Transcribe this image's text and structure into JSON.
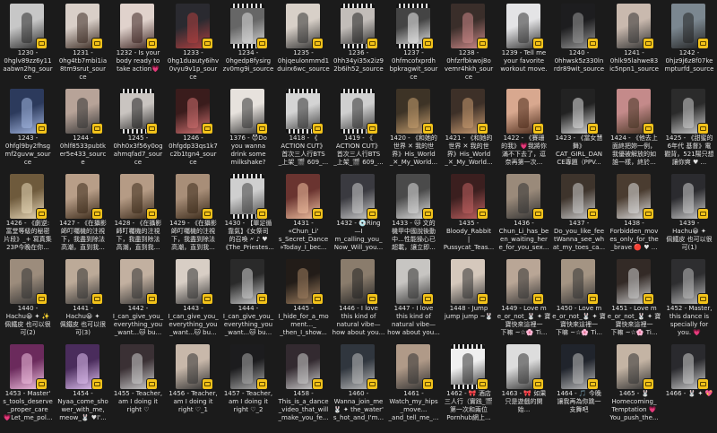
{
  "explorer": {
    "tiles": [
      {
        "name": "1230 - 0hglv89zz6y11aabwn2hg_source",
        "label": "1230 -\n0hglv89zz6y11\naabwn2hg_sour\nce",
        "bg": "#c7c7c7",
        "fg": "#2a2a2a",
        "film": false
      },
      {
        "name": "1231 - 0hgi4tb7mbi1ia8tm9srut_source",
        "label": "1231 -\n0hg4tb7mbi1ia\n8tm9srut_sour\nce",
        "bg": "#d9cfc8",
        "fg": "#3a2a22",
        "film": false
      },
      {
        "name": "1232 - Is your body ready to take action",
        "label": "1232 - Is your\nbody ready to\ntake action💗",
        "bg": "#e0d2cc",
        "fg": "#3b2320",
        "film": false
      },
      {
        "name": "1233 - 0hgl0uaeuty6ihv0vyu9v1p_source",
        "label": "1233 -\n0hg1duauty6ihv\n0vyu9v1p_sour\nce",
        "bg": "#2a2a30",
        "fg": "#b04040",
        "film": false
      },
      {
        "name": "1234",
        "label": "1234 -\n0hgedp8fysirg\nzv0mg9i_source",
        "bg": "#666",
        "fg": "#ddd",
        "film": true
      },
      {
        "name": "1235",
        "label": "1235 -\n0hjqeulonmmd1\nduirx6wc_source",
        "bg": "#d8d0c8",
        "fg": "#333",
        "film": false
      },
      {
        "name": "1236",
        "label": "1236 -\n0hh34yi35x2iz9\n2b6ih52_source",
        "bg": "#c2bdb9",
        "fg": "#222",
        "film": true
      },
      {
        "name": "1237",
        "label": "1237 -\n0hfmcofxprdh\nbpkragwit_sour\nce",
        "bg": "#444",
        "fg": "#eee",
        "film": true
      },
      {
        "name": "1238",
        "label": "1238 -\n0hfzrfbkwoj8o\nvemr4hkh_sour\nce",
        "bg": "#3a2e2a",
        "fg": "#c88",
        "film": false
      },
      {
        "name": "1239",
        "label": "1239 - Tell me\nyour favorite\nworkout move.",
        "bg": "#e4e4e6",
        "fg": "#333",
        "film": false
      },
      {
        "name": "1240",
        "label": "1240 -\n0hhwsk5z330ln\nrdr89wit_source",
        "bg": "#1d1d1f",
        "fg": "#999",
        "film": false
      },
      {
        "name": "1241",
        "label": "1241 -\n0hlk95lahwe83\nic5npn1_source",
        "bg": "#c9b9ae",
        "fg": "#333",
        "film": false
      },
      {
        "name": "1242",
        "label": "1242 -\n0hjz9j6z8f07ke\nmpturfd_source",
        "bg": "#7b8790",
        "fg": "#222",
        "film": false
      },
      {
        "name": "1243",
        "label": "1243 -\n0hfgl9by2fhsg\nmf2guvw_sour\nce",
        "bg": "#2c3a5c",
        "fg": "#a3b6e0",
        "film": false
      },
      {
        "name": "1244",
        "label": "1244 -\n0hlf8533pubtk\ner5e433_sourc\ne",
        "bg": "#b7a398",
        "fg": "#333",
        "film": false
      },
      {
        "name": "1245",
        "label": "1245 -\n0hh0x3f56y0og\nahmqfad7_sour\nce",
        "bg": "#c9c4c0",
        "fg": "#222",
        "film": true
      },
      {
        "name": "1246",
        "label": "1246 -\n0hfgdp33qs1k7\nc2b1tgn4_sour\nce",
        "bg": "#3a1c1c",
        "fg": "#d07070",
        "film": false
      },
      {
        "name": "1376",
        "label": "1376 - 😈Do\nyou wanna\ndrink some\nmilkshake?",
        "bg": "#e7e2dd",
        "fg": "#333",
        "film": false
      },
      {
        "name": "1418",
        "label": "1418 - 《\nACTION CUT》\n首次三人行BTS\n_上架_🎬 609_...",
        "bg": "#d4d4d4",
        "fg": "#333",
        "film": true
      },
      {
        "name": "1419",
        "label": "1419 - 《\nACTION CUT》\n首次三人行BTS\n_上架_🎬 609_...",
        "bg": "#cfcfcf",
        "fg": "#333",
        "film": true
      },
      {
        "name": "1420",
        "label": "1420 - 《和她的\n世界 ✕ 我的世\n界》His_World\n_✕_My_World...",
        "bg": "#3d3326",
        "fg": "#c8a070",
        "film": false
      },
      {
        "name": "1421",
        "label": "1421 - 《和她的\n世界 ✕ 我的世\n界》His_World\n_✕_My_World...",
        "bg": "#3d3028",
        "fg": "#c89a70",
        "film": false
      },
      {
        "name": "1422",
        "label": "1422 - 《賽珊\n的我》💗我將你\n滿不下去了，逗\n奈再第一次...",
        "bg": "#d8a88f",
        "fg": "#4a2a1a",
        "film": false
      },
      {
        "name": "1423",
        "label": "1423 - 《當女慧\n舞》\nCAT_GIRL_DAN\nCE專題（PPV...",
        "bg": "#222",
        "fg": "#ddd",
        "film": false
      },
      {
        "name": "1424",
        "label": "1424 - 《他去上\n面終把妳一例，\n我優被解放的如\n誰一樣，終於...",
        "bg": "#c48a8a",
        "fg": "#432",
        "film": false
      },
      {
        "name": "1425",
        "label": "1425 - 《甜蜜的\n6年代 基督》電\n觀背，521陽只想\n讓你爽 ♥ ...",
        "bg": "#2b2b2b",
        "fg": "#ccc",
        "film": false
      },
      {
        "name": "1426",
        "label": "1426 - 《劇逆:\n富堂等級的秘密\n片段》_+ 寫真集\n23P今晚在你...",
        "bg": "#6e5a3c",
        "fg": "#e8d8b8",
        "film": false
      },
      {
        "name": "1427",
        "label": "1427 - 《在攝影\n師叮囑機的注視\n下，我盡到除法\n高潮，直到我...",
        "bg": "#b89e88",
        "fg": "#3a2a1a",
        "film": false
      },
      {
        "name": "1428",
        "label": "1428 - 《在攝影\n師叮囑機的注視\n下，我盡到除法\n高潮，直到我...",
        "bg": "#b59b85",
        "fg": "#3a2a1a",
        "film": false
      },
      {
        "name": "1429",
        "label": "1429 - 《在攝影\n師叮囑機的注視\n下，我盡到除法\n高潮，直到我...",
        "bg": "#a88e78",
        "fg": "#3a2a1a",
        "film": false
      },
      {
        "name": "1430",
        "label": "1430 - 【單足循\n靠氣】《女祭司\n的召喚 🗲 ♪ ♥\n《The_Priestes...",
        "bg": "#cfcfcf",
        "fg": "#444",
        "film": true
      },
      {
        "name": "1431",
        "label": "1431 -\n«Chun_Li'\ns_Secret_Dance\n»Today_I_bec...",
        "bg": "#6a3430",
        "fg": "#f0c0a0",
        "film": false
      },
      {
        "name": "1432",
        "label": "1432 - 💿Ring\n—I\nm_calling_you_\nNow_Will_you...",
        "bg": "#3a3a40",
        "fg": "#ccc",
        "film": false
      },
      {
        "name": "1433",
        "label": "1433 - 🐱 文的\n機甲中國說後動\n中...性能操心已\n超載，讓立即...",
        "bg": "#4a4a4a",
        "fg": "#ddd",
        "film": false
      },
      {
        "name": "1435",
        "label": "1435 -\nBloody_Rabbit\n|\nPussycat_Teas...",
        "bg": "#3b1f1f",
        "fg": "#c06060",
        "film": false
      },
      {
        "name": "1436",
        "label": "1436 -\nChun_Li_has_be\nen_waiting_her\ne_for_you_sex...",
        "bg": "#9a8a7a",
        "fg": "#333",
        "film": false
      },
      {
        "name": "1437",
        "label": "1437 -\nDo_you_like_fee\ntWanna_see_wh\nat_my_toes_ca...",
        "bg": "#3e342c",
        "fg": "#ccc",
        "film": false
      },
      {
        "name": "1438",
        "label": "1438 -\nForbidden_mov\nes_only_for_the\n_brave 🔴 ♥ ...",
        "bg": "#4a3c30",
        "fg": "#ddd",
        "film": false
      },
      {
        "name": "1439",
        "label": "1439 -\nHachu😀 ✦\n佩鐵皮 也可以很\n可(1)",
        "bg": "#2b2b2f",
        "fg": "#ccc",
        "film": false
      },
      {
        "name": "1440",
        "label": "1440 -\nHachu😀 ✦ ✨\n佩鐵皮 也可以很\n可(2)",
        "bg": "#9c8c7c",
        "fg": "#333",
        "film": false
      },
      {
        "name": "1441",
        "label": "1441 -\nHachu😀 ✦\n佩鐵皮 也可以很\n可(3)",
        "bg": "#bcaa98",
        "fg": "#333",
        "film": false
      },
      {
        "name": "1442",
        "label": "1442 -\nI_can_give_you_\neverything_you\n_want...🐱 bu...",
        "bg": "#c2b0a0",
        "fg": "#333",
        "film": false
      },
      {
        "name": "1443",
        "label": "1443 -\nI_can_give_you_\neverything_you\n_want...🐱 bu...",
        "bg": "#d8cec5",
        "fg": "#333",
        "film": false
      },
      {
        "name": "1444",
        "label": "1444 -\nI_can_give_you_\neverything_you\n_want...🐱 bu...",
        "bg": "#2a2a2a",
        "fg": "#ccc",
        "film": false
      },
      {
        "name": "1445",
        "label": "1445 -\nI_hide_for_a_mo\nment..._\n_then_I_show...",
        "bg": "#221c18",
        "fg": "#a08060",
        "film": false
      },
      {
        "name": "1446",
        "label": "1446 - I love\nthis kind of\nnatural vibe—\nhow about you...",
        "bg": "#8a7c6c",
        "fg": "#222",
        "film": false
      },
      {
        "name": "1447",
        "label": "1447 - I love\nthis kind of\nnatural vibe—\nhow about you...",
        "bg": "#c7c5c2",
        "fg": "#333",
        "film": false
      },
      {
        "name": "1448",
        "label": "1448 - Jump\njump jump ~🐰",
        "bg": "#d5c8bc",
        "fg": "#333",
        "film": false
      },
      {
        "name": "1449",
        "label": "1449 - Love m\ne_or_not_🐰 ✦ 寶\n寶快來這裡一\n下嘛 ~☆🌸 Ti...",
        "bg": "#b9a696",
        "fg": "#333",
        "film": false
      },
      {
        "name": "1450",
        "label": "1450 - Love m\ne_or_not_🐰 ✦ 寶\n寶快來這裡一\n下嘛 ~☆🌸 Ti...",
        "bg": "#a49483",
        "fg": "#333",
        "film": false
      },
      {
        "name": "1451",
        "label": "1451 - Love m\ne_or_not_🐰 ✦ 寶\n寶快來這裡一\n下嘛 ~☆🌸 Ti...",
        "bg": "#332a26",
        "fg": "#ccc",
        "film": false
      },
      {
        "name": "1452",
        "label": "1452 - Master,\nthis dance is\nspecially for\nyou. 💗",
        "bg": "#2e2e30",
        "fg": "#bbb",
        "film": false
      },
      {
        "name": "1453",
        "label": "1453 - Master'\ns_tools_deserve\n_proper_care\n💗Let_me_pol...",
        "bg": "#6b2a5c",
        "fg": "#f0c0e0",
        "film": false
      },
      {
        "name": "1454",
        "label": "1454 -\nNyaa_come_sho\nwer_with_me,\nmeow_🐰 ♥I'...",
        "bg": "#4a2c5c",
        "fg": "#e0c0f0",
        "film": false
      },
      {
        "name": "1455",
        "label": "1455 - Teacher,\nam I doing it\nright ♡",
        "bg": "#3a3034",
        "fg": "#ccc",
        "film": false
      },
      {
        "name": "1456",
        "label": "1456 - Teacher,\nam I doing it\nright ♡_1",
        "bg": "#c8b8aa",
        "fg": "#333",
        "film": false
      },
      {
        "name": "1457",
        "label": "1457 - Teacher,\nam I doing it\nright ♡_2",
        "bg": "#1c1c1e",
        "fg": "#aaa",
        "film": false
      },
      {
        "name": "1458",
        "label": "1458 -\nThis_is_a_dance\n_video_that_will\n_make_you_fe...",
        "bg": "#332a30",
        "fg": "#ccc",
        "film": false
      },
      {
        "name": "1460",
        "label": "1460 -\nWanna_join_me\n🐰 ✦ the_water'\ns_hot_and_I'm...",
        "bg": "#30363e",
        "fg": "#bbb",
        "film": false
      },
      {
        "name": "1461",
        "label": "1461 -\nWatch_my_hips\n_move...\n_and_tell_me_...",
        "bg": "#b09a88",
        "fg": "#333",
        "film": false
      },
      {
        "name": "1462",
        "label": "1462 - 🎀 酒店\n三人行（實践_🎬\n第一次和兩位\nPornhub網上...",
        "bg": "#f0f0f0",
        "fg": "#333",
        "film": true
      },
      {
        "name": "1463",
        "label": "1463 - 🎀 如果\n只是遊戲的開\n始...",
        "bg": "#ddd",
        "fg": "#333",
        "film": false
      },
      {
        "name": "1464",
        "label": "1464 - 🎵 今晚\n讓我再為你跳一\n支舞吧",
        "bg": "#20242c",
        "fg": "#bbb",
        "film": false
      },
      {
        "name": "1465",
        "label": "1465 - 🐰\nHomecoming_\nTemptation 💗\nYou_push_the...",
        "bg": "#c4b4a4",
        "fg": "#333",
        "film": false
      },
      {
        "name": "1466",
        "label": "1466 - 🐰 ✦ 💖",
        "bg": "#2a2a2e",
        "fg": "#ccc",
        "film": false
      }
    ]
  }
}
